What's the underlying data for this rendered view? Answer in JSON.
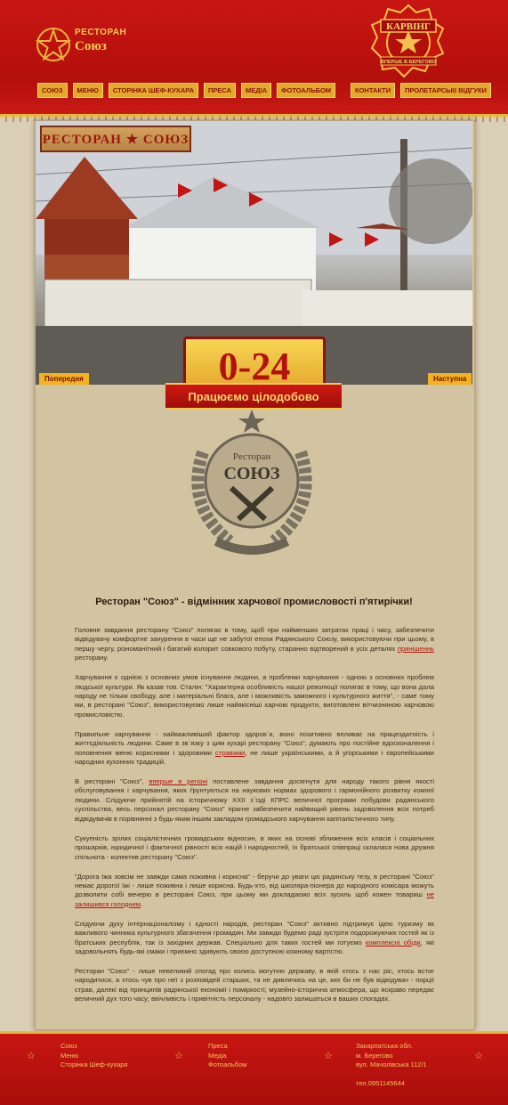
{
  "header": {
    "logo_small": "РЕСТОРАН",
    "logo_big": "Союз",
    "badge_top": "КАРВІНГ",
    "badge_bottom": "ВПЕРШЕ В БЕРЕГОВО"
  },
  "nav": {
    "left": [
      "СОЮЗ",
      "МЕНЮ",
      "СТОРІНКА ШЕФ-КУХАРА",
      "ПРЕСА",
      "МЕДІА",
      "ФОТОАЛЬБОМ"
    ],
    "right": [
      "КОНТАКТИ",
      "ПРОЛЕТАРСЬКІ ВІДГУКИ"
    ]
  },
  "slider": {
    "sign": "РЕСТОРАН ★ СОЮЗ",
    "prev": "Попередня",
    "next": "Наступна"
  },
  "hours": {
    "value": "0-24",
    "ribbon": "Працюємо цілодобово"
  },
  "emblem": {
    "small": "Ресторан",
    "big": "СОЮЗ"
  },
  "main": {
    "headline": "Ресторан \"Союз\" - відмінник харчової промисловості п'ятирічки!",
    "p1": [
      "Головне завдання ресторану \"Союз\" полягає в тому, щоб при найменших затратах праці і часу, забезпечити відвідувачу комфортне занурення в часи ще не забутої епохи Радянського Союзу, використовуючи при цьому, в першу чергу, різноманітний і багатий колорит совкового побуту, старанно відтворений в усіх деталях ",
      "принішеннь",
      " ресторану."
    ],
    "p2": "Харчування є однією з основних умов існування людини, а проблеми харчування - одною з основних проблем людської культури. Як казав тов. Сталін: \"Характерна особливість нашої революції полягає в тому, що вона дала народу не тільки свободу, але і матеріальні блага, але і можливість заможного і культурного життя\", - саме тому ми, в ресторані \"Союз\", використовуємо лише найякісніші харчові продукти, виготовлені вітчизняною харчовою промисловістю.",
    "p3": [
      "Правильне харчування - найважливіший фактор здоров`я, воно позитивно впливає на працездатність і життєдіяльність людини. Саме в зв`язку з цим кухарі ресторану \"Союз\", думають про постійне вдосконалення і поповнення меню корисними і здоровими ",
      "стравами",
      ", не лише українськими, а й угорськими і європейськими народних кухонних традицій."
    ],
    "p4": [
      "В ресторані \"Союз\", ",
      "вперше в регіоні",
      " поставлене завдання досягнути для народу такого рівня якості обслуговування і харчування, яких ґрунтуються на наукових нормах здорового і гармонійного розвитку кожної людини. Слідуючи прийнятій на історичному XXII з`їзді КПРС величної програми побудови радянського суспільства, весь персонал ресторану \"Союз\" прагне забезпечити найвищий рівень задоволення всіх потреб відвідувачів в порівнянні з будь-яким іншим закладом громадського харчування капіталістичного типу."
    ],
    "p5": "Сукупність зрілих соціалістичних громадських відносин, в яких на основі зближення всіх класів і соціальних прошарків, юридичної і фактичної рівності всіх націй і народностей, їх братської співпраці склалася нова дружня спільнота - колектив ресторану \"Союз\".",
    "p6": [
      "\"Дорога їжа зовсім не завжди сама поживна і корисна\" - беручи до уваги цю радянську тезу, в ресторані \"Союз\" немає дорогої їжі - лише поживна і лише корисна. Будь-хто, від школяра-піонера до народного комісара можуть дозволити собі вечерю в ресторані Союз, при цьому ми докладаємо всіх зусиль щоб кожен товариш ",
      "не залишився голодним",
      "."
    ],
    "p7": [
      "Слідуючи духу інтернаціоналізму і єдності народів, ресторан \"Союз\" активно підтримує ідею туризму як важливого чинника культурного збагачення громадян. Ми завжди будемо раді зустріти подорожуючих гостей як із братських республік, так із західних держав. Спеціально для таких гостей ми готуємо ",
      "комплексні обіди",
      ", які задовольнять будь-які смаки і приємно здивують своєю доступною кожному вартістю."
    ],
    "p8": "Ресторан \"Союз\" - лише невеликий спогад про колись могутню державу, в якій хтось з нас ріс, хтось встиг народитися, а хтось чув про неї з розповідей старших, та не дивлячись на це, ких би не був відвідувач - порції страв, далекі від принципів радянської економії і поміркості; музейно-історична атмосфера, що яскраво передає величний дух того часу; ввічливість і привітність персоналу - надовго залишаться в ваших спогадах."
  },
  "footer": {
    "col1": [
      "Союз",
      "Меню",
      "Сторінка Шеф-кухаря"
    ],
    "col2": [
      "Преса",
      "Медіа",
      "Фотоальбом"
    ],
    "address": [
      "Закарпатська обл.",
      "м. Берегово",
      "вул. Мачолівська 112/1"
    ],
    "phone": "тел.0951145644"
  },
  "colors": {
    "header_red": "#c81612",
    "gold": "#e2a92a",
    "paper": "#d2c4a1",
    "link": "#b3120e"
  }
}
